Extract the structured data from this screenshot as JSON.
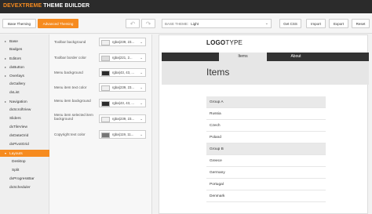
{
  "app": {
    "brand_dx": "DEVEXTREME",
    "brand_rest": " THEME BUILDER"
  },
  "toolbar": {
    "base_theming": "Base Theming",
    "advanced_theming": "Advanced Theming",
    "undo_icon": "↶",
    "redo_icon": "↷",
    "base_theme_label": "BASE THEME:",
    "base_theme_value": "Light",
    "chevron": "⌄",
    "get_css": "Get CSS",
    "import": "Import",
    "export": "Export",
    "reset": "Reset"
  },
  "nav": {
    "items": [
      {
        "label": "Base",
        "arrow": "▸"
      },
      {
        "label": "Badges",
        "arrow": ""
      },
      {
        "label": "Editors",
        "arrow": "▸"
      },
      {
        "label": "dxButton",
        "arrow": "▸"
      },
      {
        "label": "Overlays",
        "arrow": "▸"
      },
      {
        "label": "dxGallery",
        "arrow": ""
      },
      {
        "label": "dxList",
        "arrow": ""
      },
      {
        "label": "Navigation",
        "arrow": "▸"
      },
      {
        "label": "dxScrollView",
        "arrow": ""
      },
      {
        "label": "Sliders",
        "arrow": ""
      },
      {
        "label": "dxTileView",
        "arrow": ""
      },
      {
        "label": "dxDataGrid",
        "arrow": ""
      },
      {
        "label": "dxPivotGrid",
        "arrow": ""
      },
      {
        "label": "Layouts",
        "arrow": "▾"
      },
      {
        "label": "Desktop",
        "arrow": ""
      },
      {
        "label": "Split",
        "arrow": ""
      },
      {
        "label": "dxProgressBar",
        "arrow": ""
      },
      {
        "label": "dxScheduler",
        "arrow": ""
      }
    ]
  },
  "settings": {
    "rows": [
      {
        "label": "Toolbar background",
        "value": "rgba(239, 23...",
        "color": "#efefef"
      },
      {
        "label": "Toolbar border color",
        "value": "rgba(221, 2...",
        "color": "#dddddd"
      },
      {
        "label": "Menu background",
        "value": "rgba(43, 43, ...",
        "color": "#2b2b2b"
      },
      {
        "label": "Menu item text color",
        "value": "rgba(239, 23...",
        "color": "#efefef"
      },
      {
        "label": "Menu item background",
        "value": "rgba(43, 43, ...",
        "color": "#2b2b2b"
      },
      {
        "label": "Menu item selected item background",
        "value": "rgba(239, 23...",
        "color": "#efefef"
      },
      {
        "label": "Copyright text color",
        "value": "rgba(119, 11...",
        "color": "#777777"
      }
    ]
  },
  "preview": {
    "logo_bold": "LOGO",
    "logo_rest": "TYPE",
    "tabs": [
      "Items",
      "About"
    ],
    "title": "Items",
    "list": [
      {
        "label": "Group A",
        "group": true
      },
      {
        "label": "Russia",
        "group": false
      },
      {
        "label": "Czech",
        "group": false
      },
      {
        "label": "Poland",
        "group": false
      },
      {
        "label": "Group B",
        "group": true
      },
      {
        "label": "Greece",
        "group": false
      },
      {
        "label": "Germany",
        "group": false
      },
      {
        "label": "Portugal",
        "group": false
      },
      {
        "label": "Denmark",
        "group": false
      }
    ]
  },
  "colors": {
    "accent": "#f68b1f",
    "dark": "#2b2b2b"
  }
}
